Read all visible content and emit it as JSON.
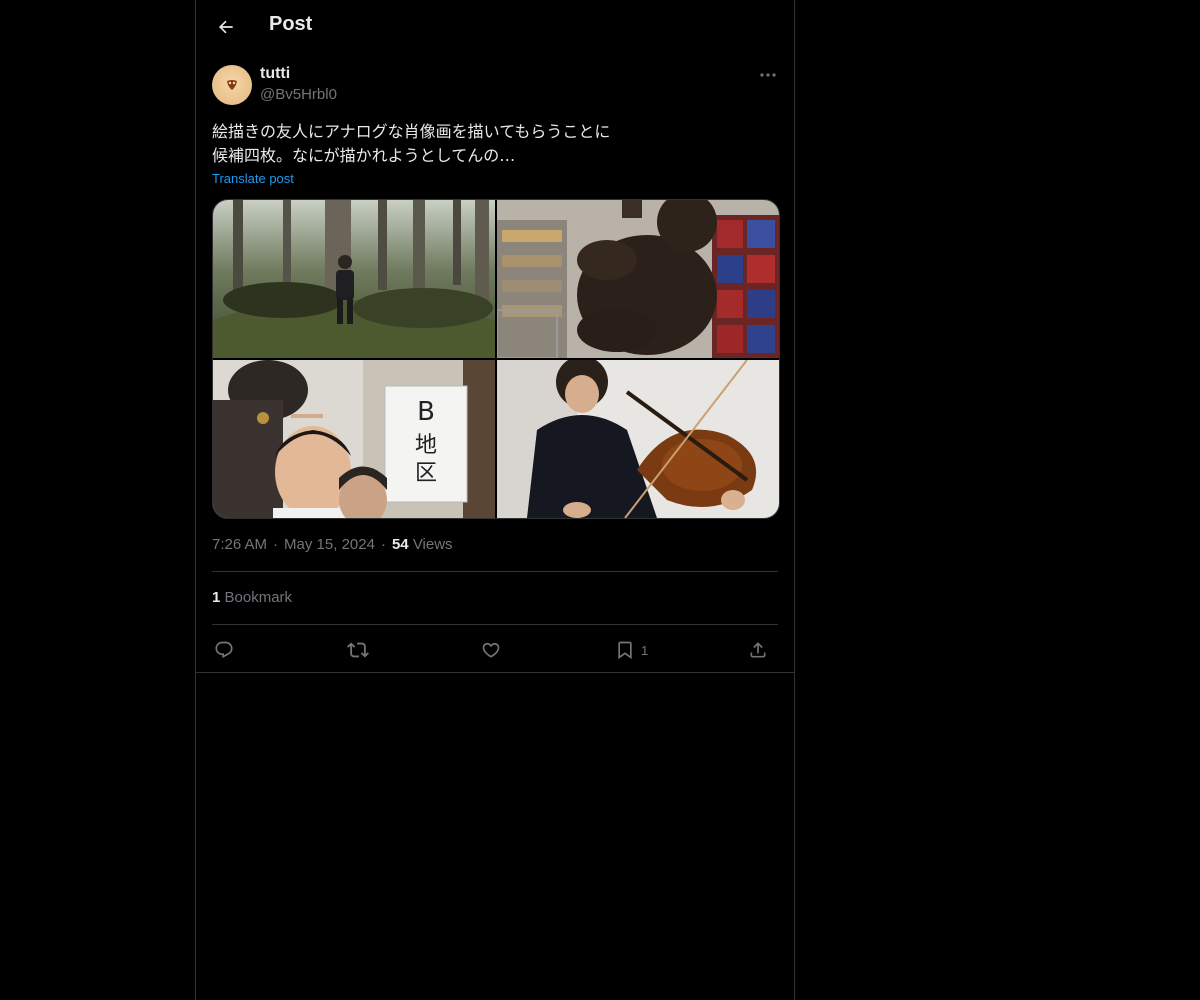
{
  "header": {
    "title": "Post",
    "back_icon": "arrow-left-icon"
  },
  "author": {
    "display_name": "tutti",
    "handle": "@Bv5Hrbl0",
    "avatar_icon": "avatar-image"
  },
  "post": {
    "text_lines": [
      "絵描きの友人にアナログな肖像画を描いてもらうことに",
      "候補四枚。なにが描かれようとしてんの…"
    ],
    "translate_label": "Translate post",
    "media": [
      {
        "description": "man sitting in forest"
      },
      {
        "description": "person holding large teddy bear in store"
      },
      {
        "description": "selfie of three people with sign",
        "sign_text": "B\n地\n区"
      },
      {
        "description": "man playing violin"
      }
    ]
  },
  "meta": {
    "time": "7:26 AM",
    "date": "May 15, 2024",
    "views_count": "54",
    "views_label": "Views"
  },
  "stats": {
    "bookmarks_count": "1",
    "bookmarks_label": "Bookmark"
  },
  "actions": {
    "reply_icon": "reply-icon",
    "repost_icon": "repost-icon",
    "like_icon": "like-icon",
    "bookmark_icon": "bookmark-icon",
    "bookmark_count": "1",
    "share_icon": "share-icon"
  },
  "colors": {
    "background": "#000000",
    "text": "#e7e9ea",
    "muted": "#71767b",
    "accent": "#1d9bf0",
    "border": "#2f3336"
  }
}
